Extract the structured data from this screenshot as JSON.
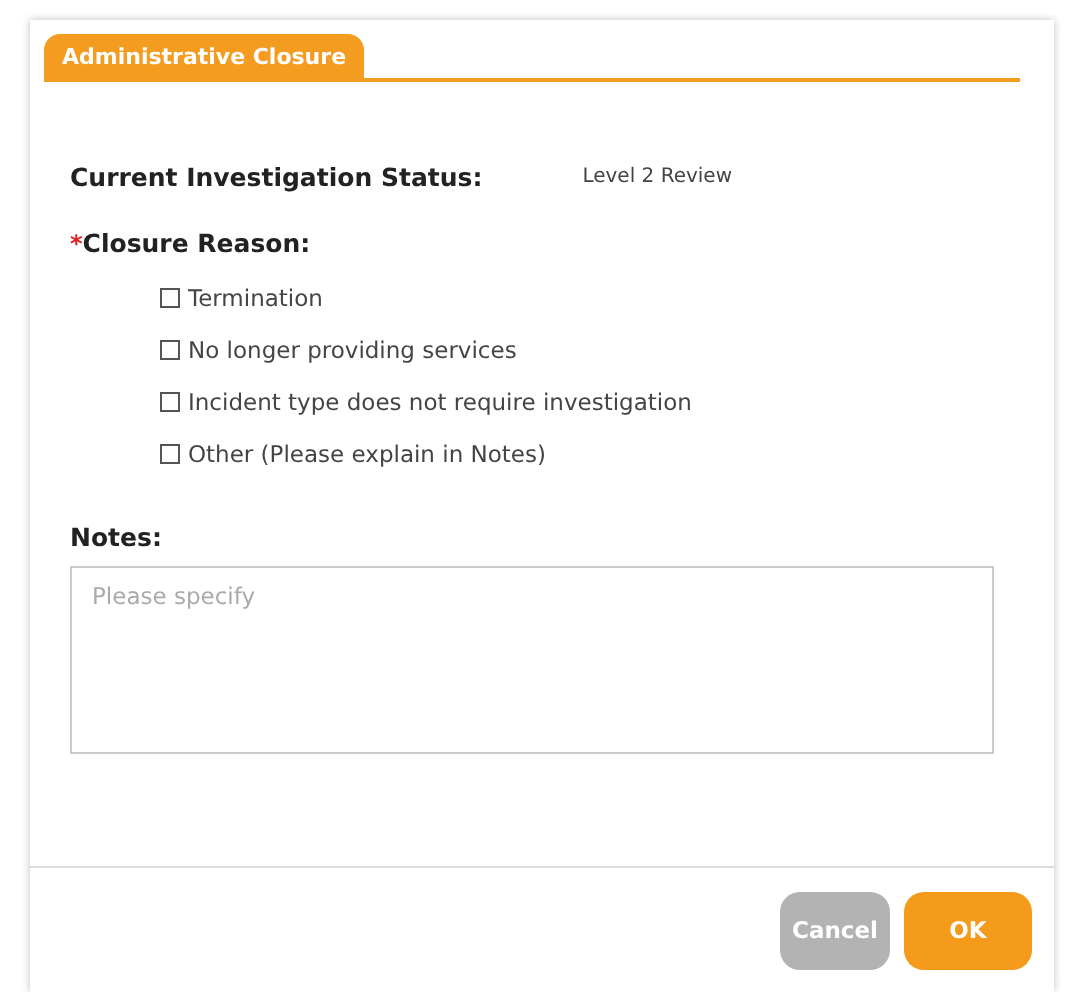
{
  "dialog": {
    "tab": {
      "label": "Administrative Closure",
      "selected": true
    },
    "status": {
      "label": "Current Investigation Status:",
      "value": "Level 2 Review"
    },
    "closure_reason": {
      "required_mark": "*",
      "label": "Closure Reason:",
      "options": [
        {
          "label": "Termination",
          "checked": false
        },
        {
          "label": "No longer providing services",
          "checked": false
        },
        {
          "label": "Incident type does not require investigation",
          "checked": false
        },
        {
          "label": "Other (Please explain in Notes)",
          "checked": false
        }
      ]
    },
    "notes": {
      "label": "Notes:",
      "placeholder": "Please specify"
    },
    "buttons": [
      {
        "label": "Cancel",
        "kind": "secondary"
      },
      {
        "label": "OK",
        "kind": "primary"
      }
    ]
  }
}
